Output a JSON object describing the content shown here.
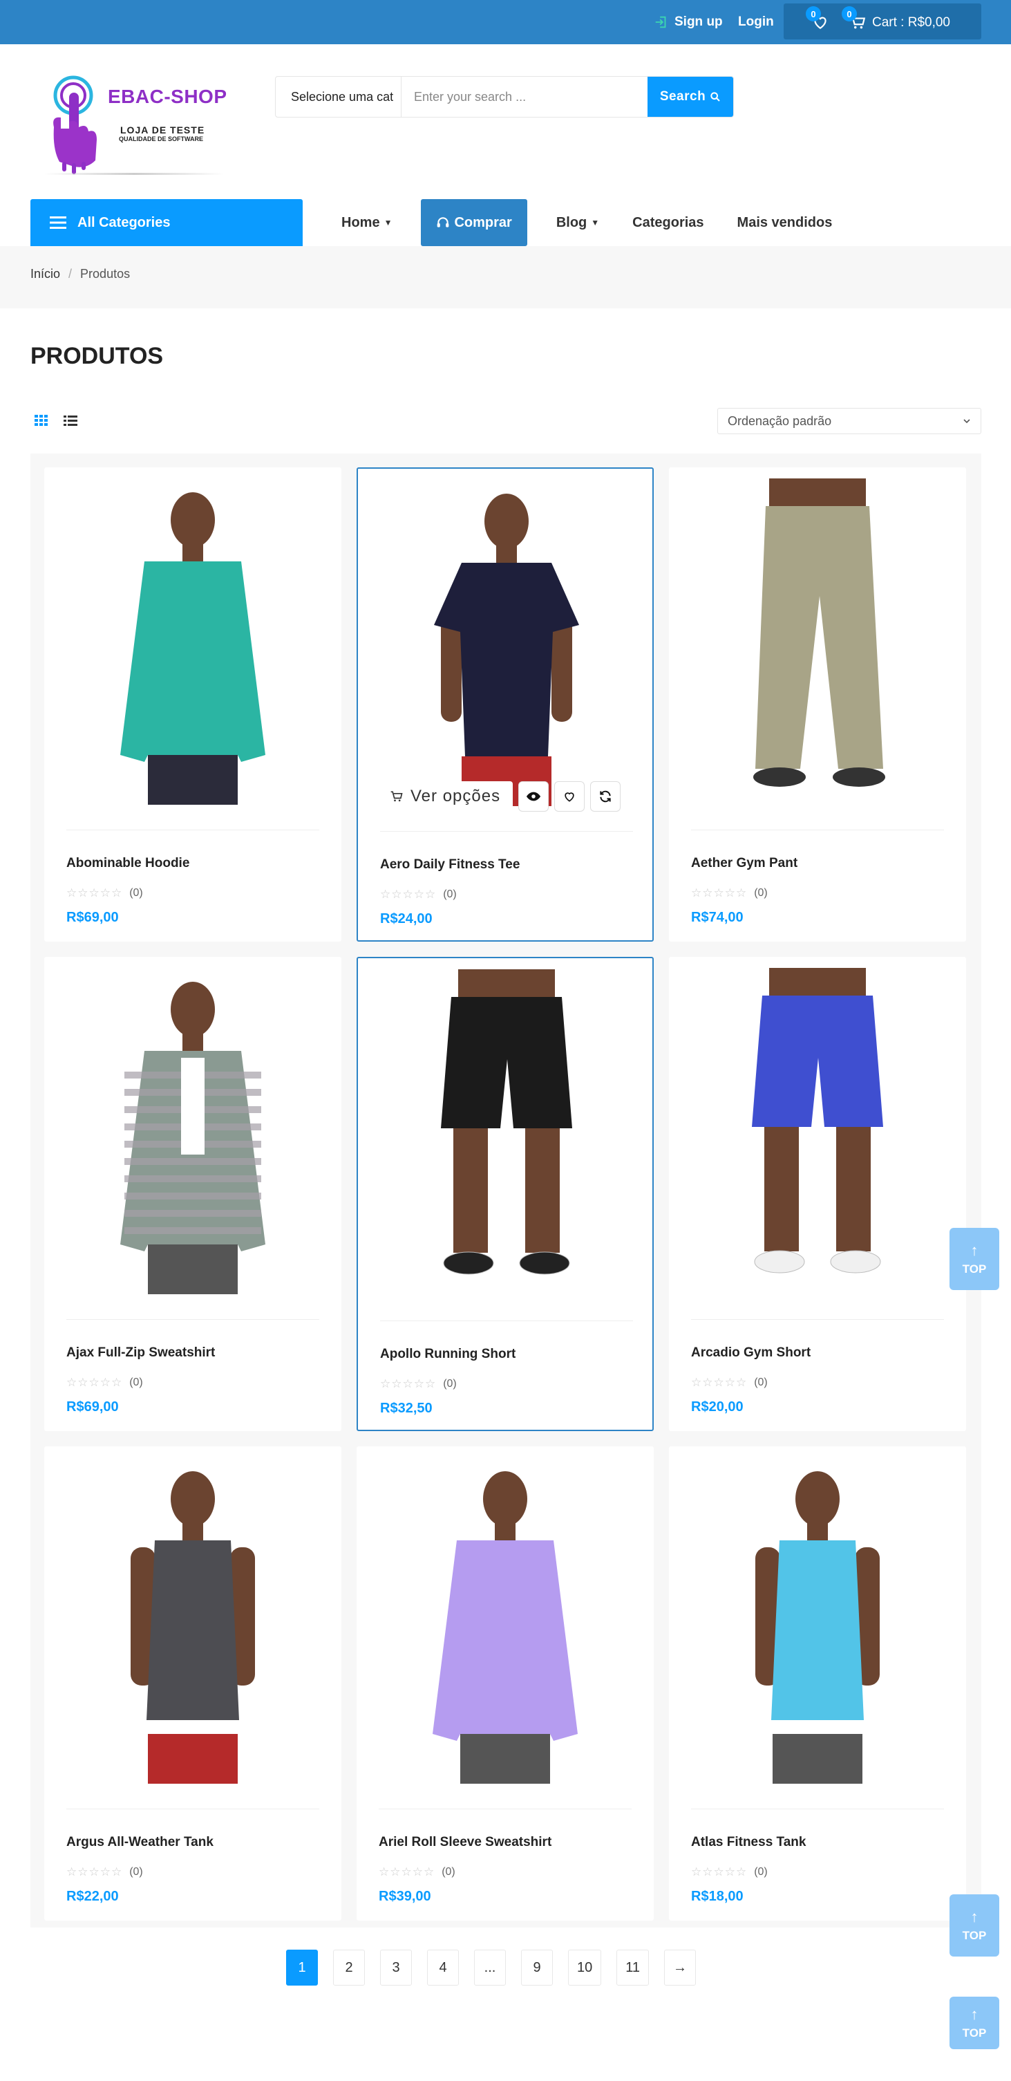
{
  "topbar": {
    "signup_label": "Sign up",
    "login_label": "Login",
    "wishlist_count": "0",
    "cart_count": "0",
    "cart_text": "Cart : R$0,00"
  },
  "header": {
    "brand": "EBAC-SHOP",
    "tagline": "LOJA DE TESTE",
    "subtagline": "QUALIDADE DE SOFTWARE",
    "search_category": "Selecione uma cat",
    "search_placeholder": "Enter your search ...",
    "search_button": "Search"
  },
  "nav": {
    "all_categories": "All Categories",
    "items": [
      "Home",
      "Comprar",
      "Blog",
      "Categorias",
      "Mais vendidos"
    ]
  },
  "breadcrumb": {
    "home": "Início",
    "separator": "/",
    "current": "Produtos"
  },
  "page_title": "PRODUTOS",
  "sort": {
    "selected": "Ordenação padrão"
  },
  "hover_actions": {
    "options_label": "Ver opções"
  },
  "products": [
    {
      "name": "Abominable Hoodie",
      "rating": "(0)",
      "price": "R$69,00",
      "shirt": "#2bb5a3",
      "pants": "#2b2b3a"
    },
    {
      "name": "Aero Daily Fitness Tee",
      "rating": "(0)",
      "price": "R$24,00",
      "shirt": "#1e1f3b",
      "pants": "#b52a2a"
    },
    {
      "name": "Aether Gym Pant",
      "rating": "(0)",
      "price": "R$74,00",
      "shirt": "none",
      "pants": "#a8a487"
    },
    {
      "name": "Ajax Full-Zip Sweatshirt",
      "rating": "(0)",
      "price": "R$69,00",
      "shirt": "#8a9a92",
      "pants": "#555555"
    },
    {
      "name": "Apollo Running Short",
      "rating": "(0)",
      "price": "R$32,50",
      "shirt": "none",
      "pants": "#1b1b1b"
    },
    {
      "name": "Arcadio Gym Short",
      "rating": "(0)",
      "price": "R$20,00",
      "shirt": "none",
      "pants": "#3f4fd0"
    },
    {
      "name": "Argus All-Weather Tank",
      "rating": "(0)",
      "price": "R$22,00",
      "shirt": "#4d4d52",
      "pants": "#b52a2a"
    },
    {
      "name": "Ariel Roll Sleeve Sweatshirt",
      "rating": "(0)",
      "price": "R$39,00",
      "shirt": "#b59cf0",
      "pants": "#555555"
    },
    {
      "name": "Atlas Fitness Tank",
      "rating": "(0)",
      "price": "R$18,00",
      "shirt": "#52c4e8",
      "pants": "#555555"
    }
  ],
  "pagination": [
    "1",
    "2",
    "3",
    "4",
    "...",
    "9",
    "10",
    "11",
    "→"
  ],
  "top_label": "TOP",
  "colors": {
    "accent": "#0a9bff",
    "topbar": "#2d84c6"
  }
}
